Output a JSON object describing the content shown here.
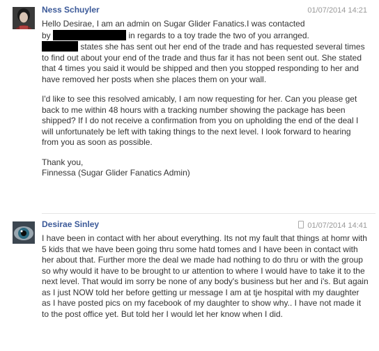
{
  "messages": [
    {
      "sender": "Ness Schuyler",
      "time": "01/07/2014 14:21",
      "p1": {
        "a": "Hello Desirae, I am an admin on Sugar Glider Fanatics.I was contacted",
        "b": "by",
        "c": "in regards to a toy trade the two of you arranged.",
        "d": "states she has sent out her end of the trade and has requested several times to find out about your end of the trade and thus far it has not been sent out. She stated that 4 times you said it would be shipped and then you stopped responding to her and have removed her posts when she places them on your wall."
      },
      "p2": "I'd like to see this resolved amicably, I am now requesting for her. Can you please get back to me within 48 hours with a tracking number showing the package has been shipped? If I do not receive a confirmation from you on upholding the end of the deal I will unfortunately be left with taking things to the next level. I look forward to hearing from you as soon as possible.",
      "p3a": "Thank you,",
      "p3b": "Finnessa (Sugar Glider Fanatics Admin)"
    },
    {
      "sender": "Desirae Sinley",
      "time": "01/07/2014 14:41",
      "body": "I have been in contact with her about everything. Its not my fault that things at homr with 5 kids that we have been going thru some hatd tomes and I have been in contact with her about that. Further more the deal we made had nothing to do thru or with the group so why would it have to be brought to ur attention to where I would have to take it to the next level. That would im sorry be none of any body's business but her and i's. But again as I just NOW told her before getting ur message I am at tje hospital with my daughter as I have posted pics on my facebook of my daughter to show why.. I have not made it to the post office yet. But told her I would let her know when I did."
    }
  ]
}
